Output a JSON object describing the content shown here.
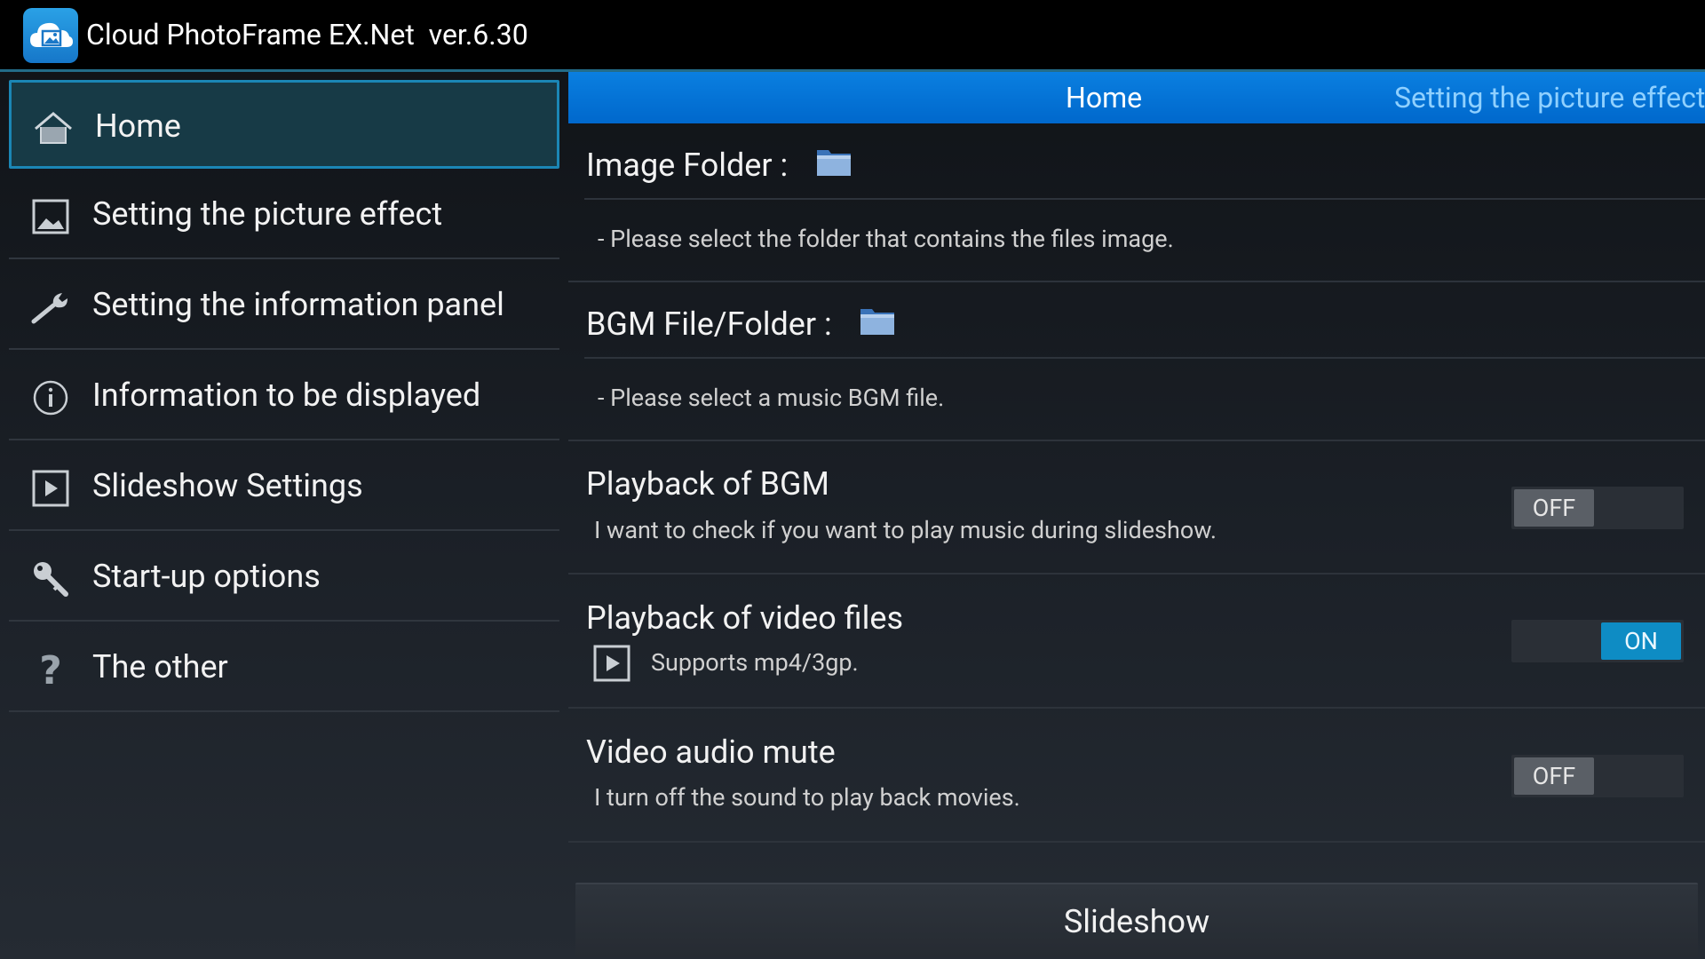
{
  "app": {
    "icon": "cloud-photo-icon",
    "title": "Cloud PhotoFrame EX.Net  ver.6.30"
  },
  "sidebar": {
    "items": [
      {
        "label": "Home",
        "icon": "home-icon",
        "active": true
      },
      {
        "label": "Setting the picture effect",
        "icon": "picture-icon"
      },
      {
        "label": "Setting the information panel",
        "icon": "wrench-icon"
      },
      {
        "label": "Information to be displayed",
        "icon": "info-icon"
      },
      {
        "label": "Slideshow Settings",
        "icon": "play-icon"
      },
      {
        "label": "Start-up options",
        "icon": "key-icon"
      },
      {
        "label": "The other",
        "icon": "question-icon"
      }
    ]
  },
  "tabs": {
    "home": "Home",
    "effect": "Setting the picture effect"
  },
  "settings": {
    "image_folder": {
      "title": "Image Folder :",
      "desc": "- Please select the folder that contains the files image.",
      "icon": "folder-icon"
    },
    "bgm": {
      "title": "BGM File/Folder :",
      "desc": "- Please select a music BGM file.",
      "icon": "folder-icon"
    },
    "playback_bgm": {
      "title": "Playback of BGM",
      "desc": "I want to check if you want to play music during slideshow.",
      "state": "OFF"
    },
    "playback_video": {
      "title": "Playback of video files",
      "desc": "Supports mp4/3gp.",
      "state": "ON",
      "icon": "video-play-icon"
    },
    "video_mute": {
      "title": "Video audio mute",
      "desc": "I turn off the sound to play back movies.",
      "state": "OFF"
    }
  },
  "slideshow_button": "Slideshow",
  "colors": {
    "accent": "#33b5e5",
    "tabbar": "#0a7fe0",
    "toggle_on": "#0e8cc4",
    "active_nav": "#173a46"
  }
}
